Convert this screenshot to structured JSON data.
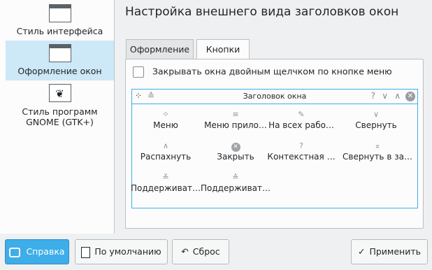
{
  "sidebar": {
    "items": [
      {
        "label": "Стиль интерфейса",
        "icon": "window-icon"
      },
      {
        "label": "Оформление окон",
        "icon": "window-icon",
        "selected": true
      },
      {
        "label": "Стиль программ GNOME (GTK+)",
        "icon": "gtk-icon"
      }
    ]
  },
  "page": {
    "title": "Настройка внешнего вида заголовков окон"
  },
  "tabs": [
    {
      "label": "Оформление"
    },
    {
      "label": "Кнопки",
      "active": true
    }
  ],
  "options": {
    "double_click_close_label": "Закрывать окна двойным щелчком по кнопке меню",
    "double_click_close_checked": false
  },
  "preview": {
    "window_title": "Заголовок окна"
  },
  "buttons": [
    {
      "glyph": "⁘",
      "label": "Меню"
    },
    {
      "glyph": "≡",
      "label": "Меню прило…"
    },
    {
      "glyph": "✎",
      "label": "На всех рабо…"
    },
    {
      "glyph": "∨",
      "label": "Свернуть"
    },
    {
      "glyph": "∧",
      "label": "Распахнуть"
    },
    {
      "glyph": "✕",
      "label": "Закрыть"
    },
    {
      "glyph": "?",
      "label": "Контекстная …"
    },
    {
      "glyph": "⌅",
      "label": "Свернуть в за…"
    },
    {
      "glyph": "≚",
      "label": "Поддерживат…"
    },
    {
      "glyph": "≙",
      "label": "Поддерживат…"
    }
  ],
  "footer": {
    "help": "Справка",
    "defaults": "По умолчанию",
    "reset": "Сброс",
    "apply": "Применить"
  },
  "colors": {
    "accent": "#3daee9",
    "selection": "#cde8f6",
    "background": "#eff0f1"
  }
}
